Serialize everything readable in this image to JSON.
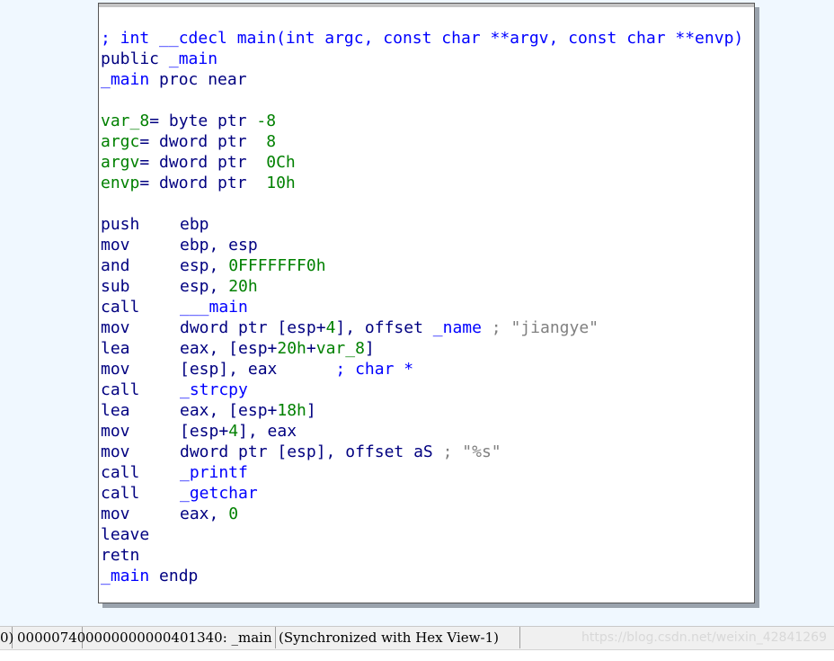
{
  "code": {
    "signature": "; int __cdecl main(int argc, const char **argv, const char **envp)",
    "public_kw": "public",
    "public_name": "_main",
    "proc_name": "_main",
    "proc_kw": "proc near",
    "vars": [
      {
        "name": "var_8",
        "def": "= byte ptr ",
        "value": "-8"
      },
      {
        "name": "argc",
        "def": "= dword ptr  ",
        "value": "8"
      },
      {
        "name": "argv",
        "def": "= dword ptr  ",
        "value": "0Ch"
      },
      {
        "name": "envp",
        "def": "= dword ptr  ",
        "value": "10h"
      }
    ],
    "instructions": [
      {
        "mn": "push",
        "op": "ebp"
      },
      {
        "mn": "mov",
        "op": "ebp, esp"
      },
      {
        "mn": "and",
        "op_a": "esp, ",
        "op_num": "0FFFFFFF0h"
      },
      {
        "mn": "sub",
        "op_a": "esp, ",
        "op_num": "20h"
      },
      {
        "mn": "call",
        "sym": "___main"
      },
      {
        "mn": "mov",
        "op_a": "dword ptr [esp+",
        "op_num": "4",
        "op_b": "], offset ",
        "sym": "_name",
        "comment": " ; \"jiangye\""
      },
      {
        "mn": "lea",
        "op_a": "eax, [esp+",
        "op_num": "20h",
        "op_b": "+",
        "var": "var_8",
        "op_c": "]"
      },
      {
        "mn": "mov",
        "op": "[esp], eax",
        "comment_blue": "      ; char *"
      },
      {
        "mn": "call",
        "sym": "_strcpy"
      },
      {
        "mn": "lea",
        "op_a": "eax, [esp+",
        "op_num": "18h",
        "op_b": "]"
      },
      {
        "mn": "mov",
        "op_a": "[esp+",
        "op_num": "4",
        "op_b": "], eax"
      },
      {
        "mn": "mov",
        "op": "dword ptr [esp], offset aS",
        "comment": " ; \"%s\""
      },
      {
        "mn": "call",
        "sym": "_printf"
      },
      {
        "mn": "call",
        "sym": "_getchar"
      },
      {
        "mn": "mov",
        "op_a": "eax, ",
        "op_num": "0"
      },
      {
        "mn": "leave"
      },
      {
        "mn": "retn"
      }
    ],
    "endp_name": "_main",
    "endp_kw": "endp"
  },
  "status_bar": {
    "seg0": "0)",
    "offset": "00000740",
    "address": "0000000000401340: _main",
    "sync": "(Synchronized with Hex View-1)",
    "watermark": "https://blog.csdn.net/weixin_42841269"
  },
  "colors": {
    "mnemonic": "#000080",
    "number": "#008000",
    "symbol": "#0000ff",
    "comment": "#808080",
    "background": "#f0f8ff"
  }
}
